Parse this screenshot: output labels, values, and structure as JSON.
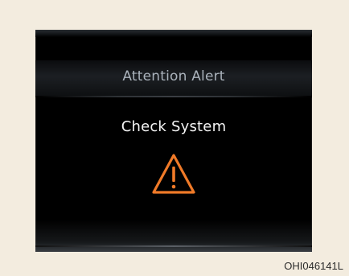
{
  "screen": {
    "title": "Attention Alert",
    "message": "Check System",
    "icon": "warning-triangle-icon",
    "accent_color": "#f07a28",
    "title_color": "#aab2bb",
    "message_color": "#f4f4f4"
  },
  "figure_code": "OHI046141L"
}
